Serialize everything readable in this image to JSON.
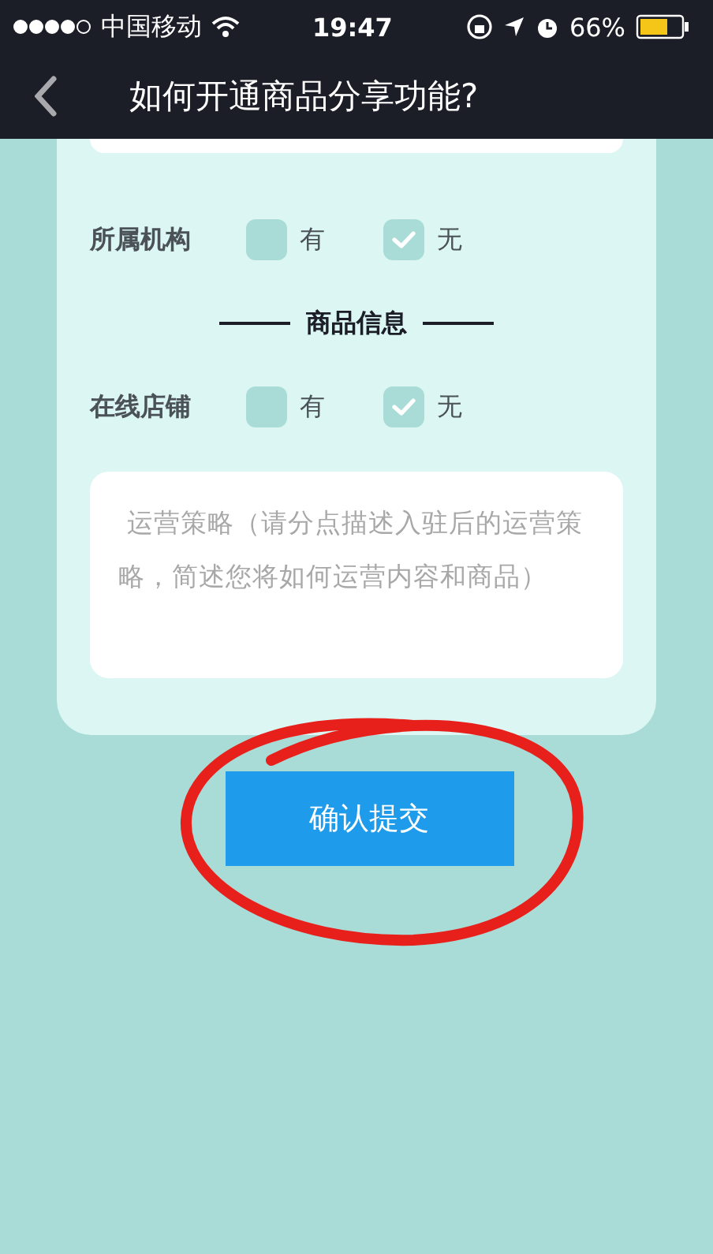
{
  "status_bar": {
    "carrier": "中国移动",
    "time": "19:47",
    "battery": "66%"
  },
  "nav": {
    "title": "如何开通商品分享功能?"
  },
  "form": [
    {
      "kind": "choice",
      "label": "所属机构",
      "options": [
        {
          "label": "有",
          "checked": false
        },
        {
          "label": "无",
          "checked": true
        }
      ]
    },
    {
      "kind": "heading",
      "label": "商品信息"
    },
    {
      "kind": "choice",
      "label": "在线店铺",
      "options": [
        {
          "label": "有",
          "checked": false
        },
        {
          "label": "无",
          "checked": true
        }
      ]
    },
    {
      "kind": "textarea",
      "placeholder": " 运营策略（请分点描述入驻后的运营策略，简述您将如何运营内容和商品）"
    }
  ],
  "submit": {
    "label": "确认提交"
  }
}
